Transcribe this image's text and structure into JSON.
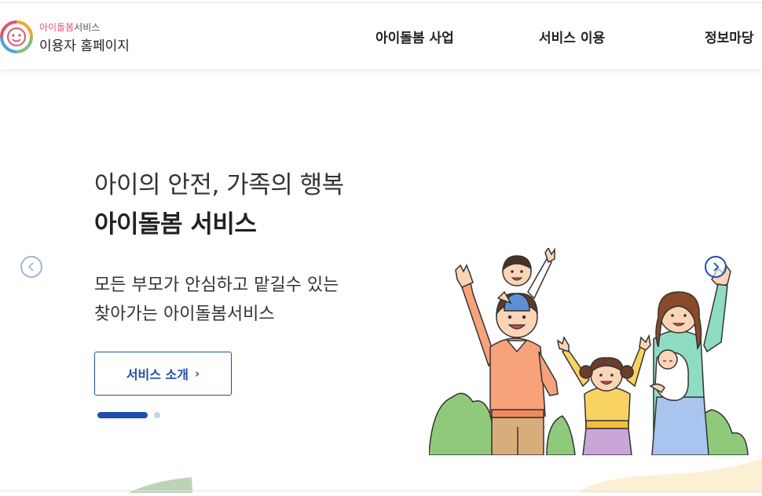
{
  "logo": {
    "sub_accent": "아이돌봄",
    "sub_rest": "서비스",
    "main": "이용자 홈페이지"
  },
  "nav": {
    "items": [
      {
        "label": "아이돌봄 사업"
      },
      {
        "label": "서비스 이용"
      },
      {
        "label": "정보마당"
      }
    ]
  },
  "hero": {
    "title_line1": "아이의 안전, 가족의 행복",
    "title_line2": "아이돌봄 서비스",
    "desc_line1": "모든 부모가 안심하고 맡길수 있는",
    "desc_line2": "찾아가는 아이돌봄서비스",
    "cta_label": "서비스 소개",
    "cta_arrow": "›"
  },
  "carousel": {
    "current_slide": 1,
    "total_slides": 2
  },
  "colors": {
    "primary": "#1e4fa8",
    "accent_pink": "#e0536e",
    "dot_inactive": "#c7d3e6",
    "blob_yellow": "#fbf0d3",
    "blob_green": "#bcd3b6"
  },
  "icons": {
    "logo": "smiley-logo-icon",
    "prev": "chevron-left-icon",
    "next": "chevron-right-icon"
  }
}
